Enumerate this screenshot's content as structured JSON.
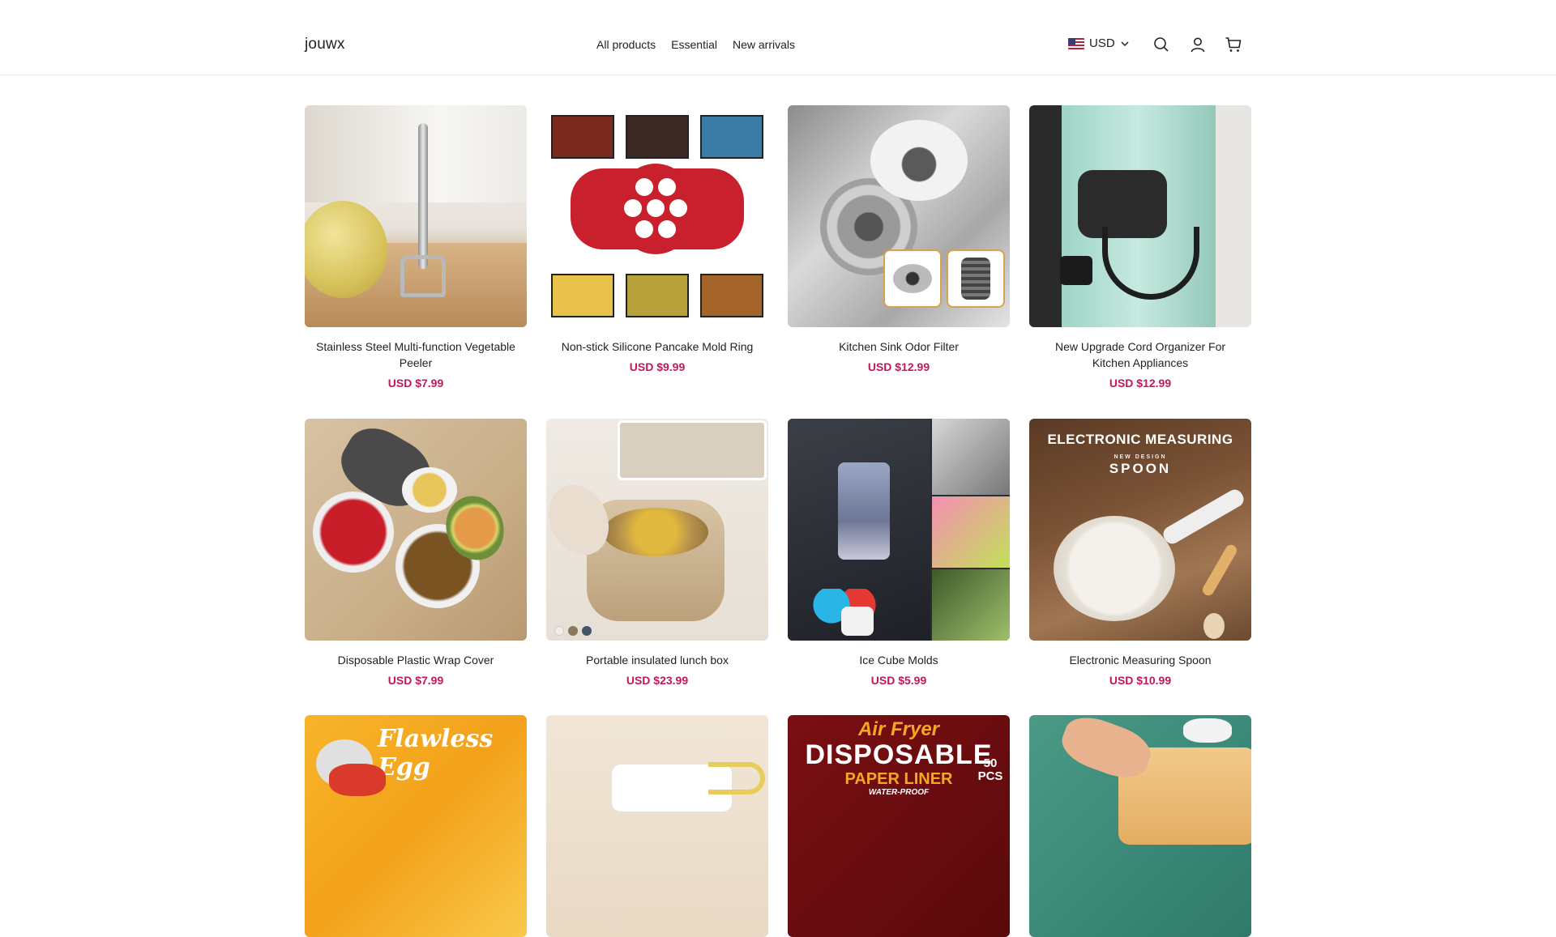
{
  "header": {
    "logo": "jouwx",
    "nav": [
      "All products",
      "Essential",
      "New arrivals"
    ],
    "currency": "USD"
  },
  "products": [
    {
      "title": "Stainless Steel Multi-function Vegetable Peeler",
      "price": "USD $7.99"
    },
    {
      "title": "Non-stick Silicone Pancake Mold Ring",
      "price": "USD $9.99"
    },
    {
      "title": "Kitchen Sink Odor Filter",
      "price": "USD $12.99"
    },
    {
      "title": "New Upgrade Cord Organizer For Kitchen Appliances",
      "price": "USD $12.99"
    },
    {
      "title": "Disposable Plastic Wrap Cover",
      "price": "USD $7.99"
    },
    {
      "title": "Portable insulated lunch box",
      "price": "USD $23.99"
    },
    {
      "title": "Ice Cube Molds",
      "price": "USD $5.99"
    },
    {
      "title": "Electronic Measuring Spoon",
      "price": "USD $10.99"
    }
  ],
  "image_text": {
    "measuring_title": "ELECTRONIC MEASURING",
    "measuring_sub": "NEW DESIGN",
    "measuring_spoon": "SPOON",
    "egg": "Flawless Egg",
    "airfryer_1": "Air Fryer",
    "airfryer_2": "DISPOSABLE",
    "airfryer_3": "PAPER LINER",
    "airfryer_4": "WATER-PROOF",
    "airfryer_pcs": "50 PCS"
  },
  "colors": {
    "price": "#c2185b"
  }
}
